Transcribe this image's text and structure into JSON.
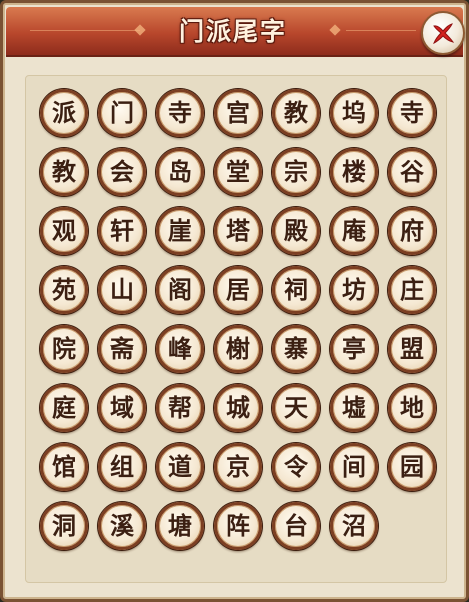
{
  "dialog": {
    "title": "门派尾字",
    "close_icon": "close-x-icon",
    "colors": {
      "header": "#b8472c",
      "panel": "#ece3cf",
      "tile_border": "#7c3f22",
      "text": "#3b1f12",
      "close_x": "#d3221f"
    }
  },
  "suffixes": [
    "派",
    "门",
    "寺",
    "宫",
    "教",
    "坞",
    "寺",
    "教",
    "会",
    "岛",
    "堂",
    "宗",
    "楼",
    "谷",
    "观",
    "轩",
    "崖",
    "塔",
    "殿",
    "庵",
    "府",
    "苑",
    "山",
    "阁",
    "居",
    "祠",
    "坊",
    "庄",
    "院",
    "斋",
    "峰",
    "榭",
    "寨",
    "亭",
    "盟",
    "庭",
    "域",
    "帮",
    "城",
    "天",
    "墟",
    "地",
    "馆",
    "组",
    "道",
    "京",
    "令",
    "间",
    "园",
    "洞",
    "溪",
    "塘",
    "阵",
    "台",
    "沼"
  ]
}
